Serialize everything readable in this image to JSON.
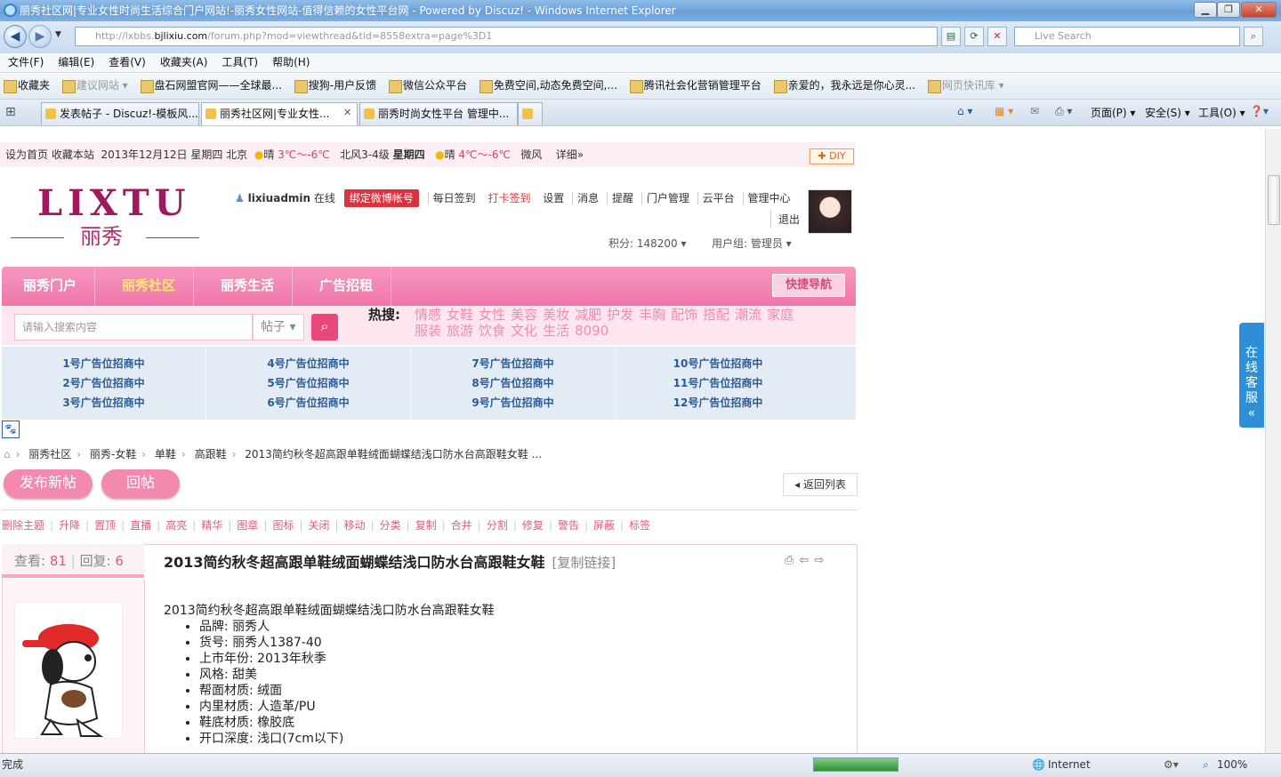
{
  "window": {
    "title": "丽秀社区网|专业女性时尚生活综合门户网站!-丽秀女性网站-值得信赖的女性平台网 - Powered by Discuz! - Windows Internet Explorer",
    "min": "▁",
    "max": "❐",
    "close": "✕"
  },
  "address": {
    "url_pre": "http://lxbbs.",
    "url_domain": "bjlixiu.com",
    "url_post": "/forum.php?mod=viewthread&tid=8558extra=page%3D1",
    "search_placeholder": "Live Search"
  },
  "menu": [
    "文件(F)",
    "编辑(E)",
    "查看(V)",
    "收藏夹(A)",
    "工具(T)",
    "帮助(H)"
  ],
  "favorites": {
    "label": "收藏夹",
    "items": [
      "建议网站 ▾",
      "盘石网盟官网——全球最...",
      "搜狗-用户反馈",
      "微信公众平台",
      "免费空间,动态免费空间,...",
      "腾讯社会化营销管理平台",
      "亲爱的，我永远是你心灵...",
      "网页快讯库 ▾"
    ]
  },
  "tabs": [
    "发表帖子 - Discuz!-模板风...",
    "丽秀社区网|专业女性...",
    "丽秀时尚女性平台 管理中..."
  ],
  "tools": {
    "page": "页面(P) ▾",
    "safety": "安全(S) ▾",
    "tools": "工具(O) ▾"
  },
  "topinfo": {
    "links": "设为首页  收藏本站",
    "date": "2013年12月12日 星期四  北京",
    "w1": "晴",
    "t1": "3℃～-6℃",
    "wind1": "北风3-4级",
    "day2": "星期四",
    "w2": "晴",
    "t2": "4℃～-6℃",
    "wind2": "微风",
    "detail": "详细»",
    "diy": "✚ DIY"
  },
  "logo": {
    "latin": "LIXTU",
    "cn": "丽秀"
  },
  "user": {
    "name": "lixiuadmin",
    "online": "在线",
    "weibo": "绑定微博帐号",
    "links": [
      "每日签到",
      "打卡签到",
      "设置",
      "消息",
      "提醒",
      "门户管理",
      "云平台",
      "管理中心"
    ],
    "logout": "退出",
    "points": "积分: 148200 ▾",
    "group": "用户组: 管理员 ▾"
  },
  "nav": {
    "items": [
      "丽秀门户",
      "丽秀社区",
      "丽秀生活",
      "广告招租"
    ],
    "quick": "快捷导航"
  },
  "search": {
    "placeholder": "请输入搜索内容",
    "type": "帖子 ▾",
    "hot_label": "热搜:",
    "hot": [
      "情感",
      "女鞋",
      "女性",
      "美容",
      "美妆",
      "减肥",
      "护发",
      "丰胸",
      "配饰",
      "搭配",
      "潮流",
      "家庭",
      "服装",
      "旅游",
      "饮食",
      "文化",
      "生活",
      "8090"
    ]
  },
  "ads": [
    [
      "1号广告位招商中",
      "2号广告位招商中",
      "3号广告位招商中"
    ],
    [
      "4号广告位招商中",
      "5号广告位招商中",
      "6号广告位招商中"
    ],
    [
      "7号广告位招商中",
      "8号广告位招商中",
      "9号广告位招商中"
    ],
    [
      "10号广告位招商中",
      "11号广告位招商中",
      "12号广告位招商中"
    ]
  ],
  "breadcrumb": [
    "丽秀社区",
    "丽秀-女鞋",
    "单鞋",
    "高跟鞋",
    "2013简约秋冬超高跟单鞋绒面蝴蝶结浅口防水台高跟鞋女鞋 ..."
  ],
  "buttons": {
    "new_post": "发布新帖",
    "reply": "回帖",
    "back": "◂ 返回列表"
  },
  "moderation": [
    "删除主题",
    "升降",
    "置顶",
    "直播",
    "高亮",
    "精华",
    "图章",
    "图标",
    "关闭",
    "移动",
    "分类",
    "复制",
    "合并",
    "分割",
    "修复",
    "警告",
    "屏蔽",
    "标签"
  ],
  "thread": {
    "views_label": "查看:",
    "views": "81",
    "replies_label": "回复:",
    "replies": "6",
    "title": "2013简约秋冬超高跟单鞋绒面蝴蝶结浅口防水台高跟鞋女鞋",
    "copy_link": "[复制链接]",
    "body_title": "2013简约秋冬超高跟单鞋绒面蝴蝶结浅口防水台高跟鞋女鞋",
    "specs": [
      "品牌: 丽秀人",
      "货号: 丽秀人1387-40",
      "上市年份: 2013年秋季",
      "风格: 甜美",
      "帮面材质: 绒面",
      "内里材质: 人造革/PU",
      "鞋底材质: 橡胶底",
      "开口深度: 浅口(7cm以下)"
    ]
  },
  "service": "在线客服",
  "status": {
    "done": "完成",
    "zone": "Internet",
    "zoom": "100%"
  }
}
